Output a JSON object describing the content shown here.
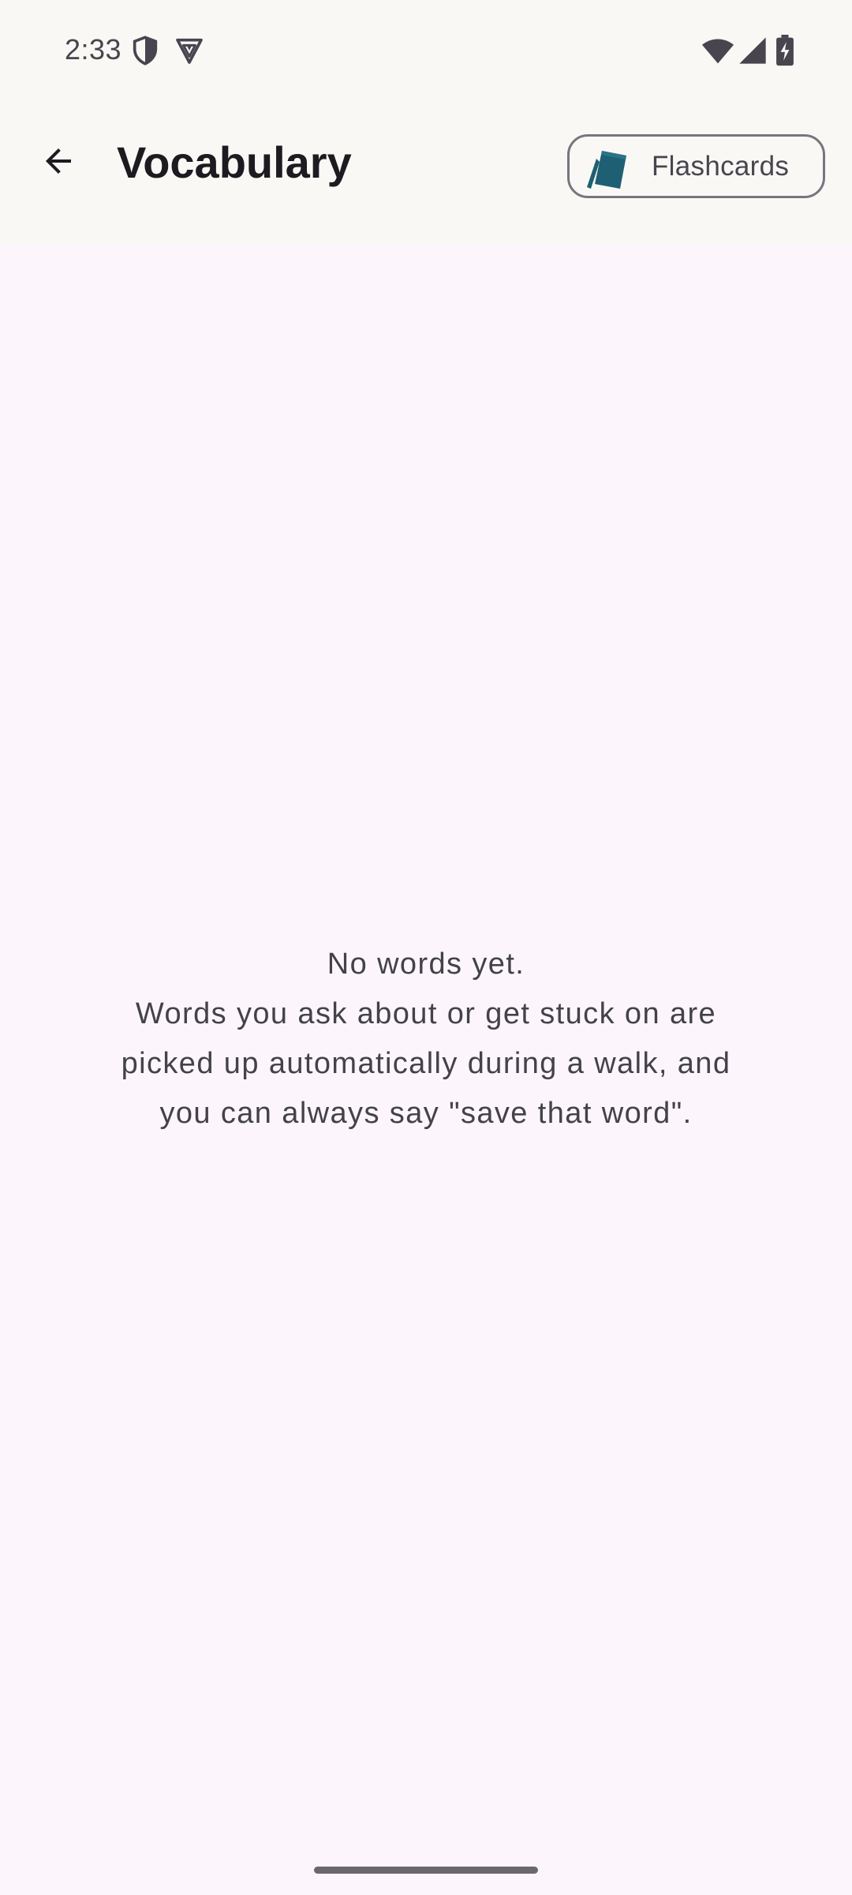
{
  "status_bar": {
    "time": "2:33",
    "left_icons": [
      "shield-icon",
      "vpn-shield-icon"
    ],
    "right_icons": [
      "wifi-icon",
      "cellular-signal-icon",
      "battery-charging-icon"
    ]
  },
  "app_bar": {
    "back_icon": "arrow-back-icon",
    "title": "Vocabulary",
    "flashcards_button": {
      "label": "Flashcards",
      "icon": "flashcards-icon"
    }
  },
  "empty_state": {
    "line1": "No words yet.",
    "line2": "Words you ask about or get stuck on are",
    "line3": "picked up automatically during a walk, and",
    "line4": "you can always say \"save that word\"."
  },
  "colors": {
    "background": "#fcf6fc",
    "app_bar_background": "#faf8f5",
    "flashcards_icon": "#1f5f73",
    "text_primary": "#1d1b20",
    "text_secondary": "#444249"
  }
}
